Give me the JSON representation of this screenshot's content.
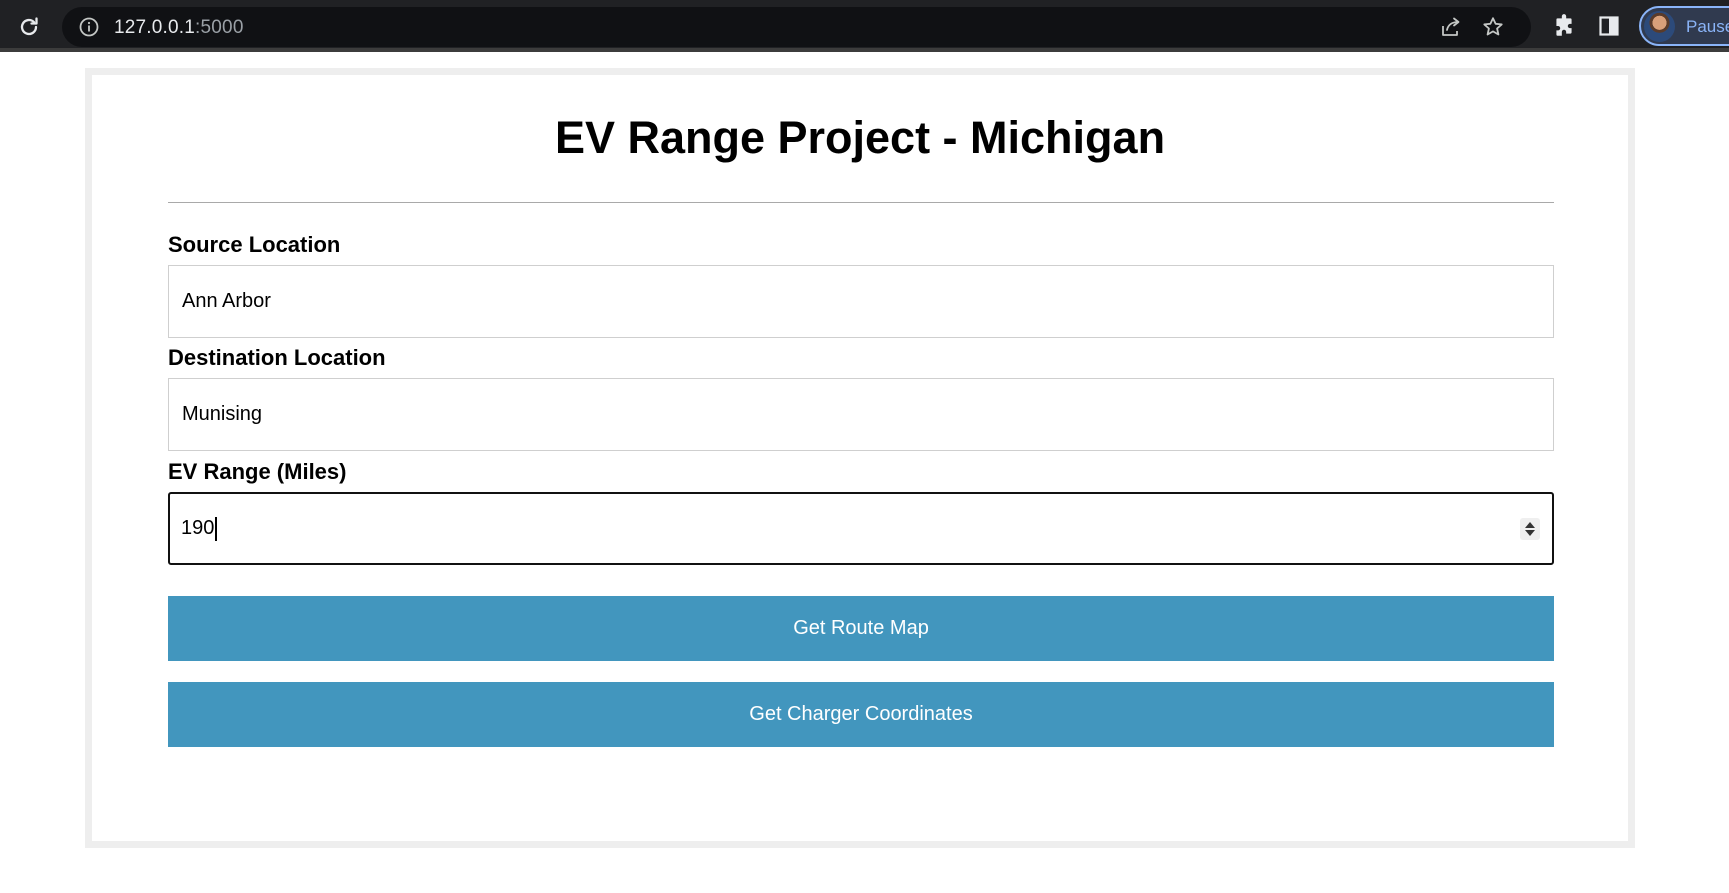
{
  "browser": {
    "url_host": "127.0.0.1",
    "url_port": ":5000",
    "profile_status": "Paused"
  },
  "page": {
    "title": "EV Range Project - Michigan",
    "source": {
      "label": "Source Location",
      "value": "Ann Arbor"
    },
    "destination": {
      "label": "Destination Location",
      "value": "Munising"
    },
    "range": {
      "label": "EV Range (Miles)",
      "value": "190"
    },
    "buttons": {
      "route_map": "Get Route Map",
      "charger_coords": "Get Charger Coordinates"
    }
  },
  "colors": {
    "button_bg": "#4296be",
    "chrome_bg": "#202124",
    "profile_accent": "#8ab4f8"
  }
}
